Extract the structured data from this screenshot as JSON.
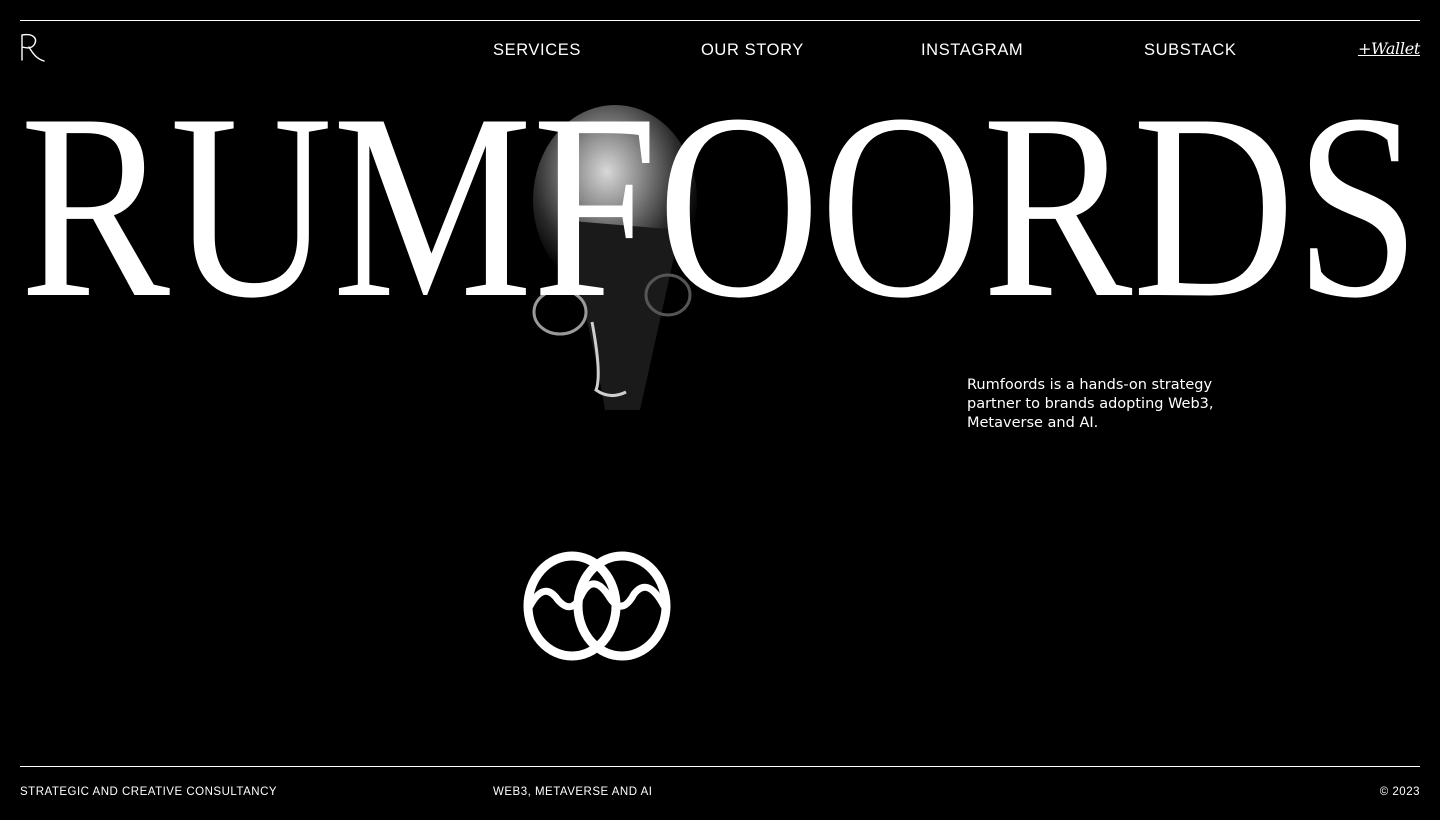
{
  "brand": {
    "logo_mark": "R",
    "wordmark": "RUMFOORDS"
  },
  "nav": {
    "items": [
      {
        "label": "SERVICES"
      },
      {
        "label": "OUR STORY"
      },
      {
        "label": "INSTAGRAM"
      },
      {
        "label": "SUBSTACK"
      }
    ],
    "wallet_label": "+Wallet"
  },
  "hero": {
    "tagline": "Rumfoords is a hands-on strategy partner to brands adopting Web3, Metaverse and AI."
  },
  "footer": {
    "left": "STRATEGIC AND CREATIVE CONSULTANCY",
    "middle": "WEB3, METAVERSE AND AI",
    "right": "© 2023"
  },
  "colors": {
    "background": "#000000",
    "foreground": "#ffffff"
  },
  "icons": {
    "logo": "r-monogram-icon",
    "emblem": "double-ring-wave-emblem-icon"
  }
}
